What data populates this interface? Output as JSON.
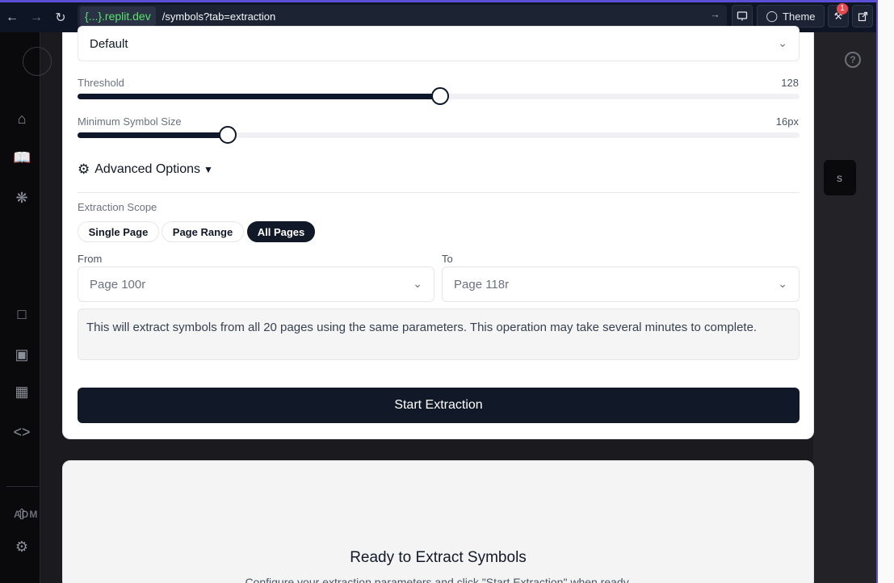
{
  "browser": {
    "host": "{...}.replit.dev",
    "path": "/symbols?tab=extraction",
    "theme_label": "Theme",
    "notification_count": "1"
  },
  "sidebar": {
    "admin_heading": "ADM"
  },
  "settings": {
    "preset_value": "Default",
    "threshold": {
      "label": "Threshold",
      "value_text": "128",
      "value": 128,
      "min": 0,
      "max": 255
    },
    "min_symbol_size": {
      "label": "Minimum Symbol Size",
      "value_text": "16px",
      "value": 16,
      "min": 0,
      "max": 77
    },
    "advanced_label": "Advanced Options",
    "advanced_caret": "▼",
    "scope_label": "Extraction Scope",
    "scope_options": [
      "Single Page",
      "Page Range",
      "All Pages"
    ],
    "scope_selected": "All Pages",
    "from_label": "From",
    "to_label": "To",
    "from_value": "Page 100r",
    "to_value": "Page 118r",
    "info_text": "This will extract symbols from all 20 pages using the same parameters. This operation may take several minutes to complete.",
    "start_button": "Start Extraction"
  },
  "empty_state": {
    "title": "Ready to Extract Symbols",
    "subtitle": "Configure your extraction parameters and click \"Start Extraction\" when ready."
  },
  "colors": {
    "primary": "#111827",
    "url_host": "#58e36b",
    "accent_border": "#5b4fd6"
  }
}
